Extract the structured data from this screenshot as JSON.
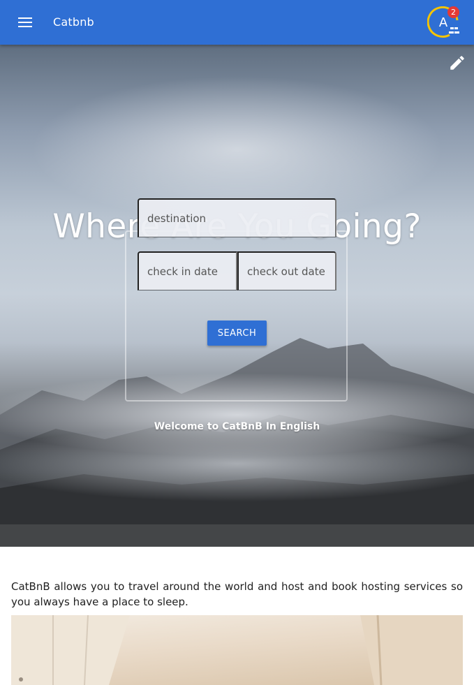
{
  "appbar": {
    "title": "Catbnb",
    "menu_icon": "menu-icon",
    "accessibility_icon": "accessibility-icon",
    "accessibility_letter": "A",
    "notification_count": "2",
    "color": "#2f6fd4"
  },
  "hero": {
    "title": "Where Are You Going?",
    "edit_icon": "pencil-icon",
    "welcome": "Welcome to CatBnB In English"
  },
  "search": {
    "destination_placeholder": "destination",
    "checkin_placeholder": "check in date",
    "checkout_placeholder": "check out date",
    "button_label": "SEARCH"
  },
  "about": {
    "text": "CatBnB allows you to travel around the world and host and book hosting services so you always have a place to sleep."
  }
}
